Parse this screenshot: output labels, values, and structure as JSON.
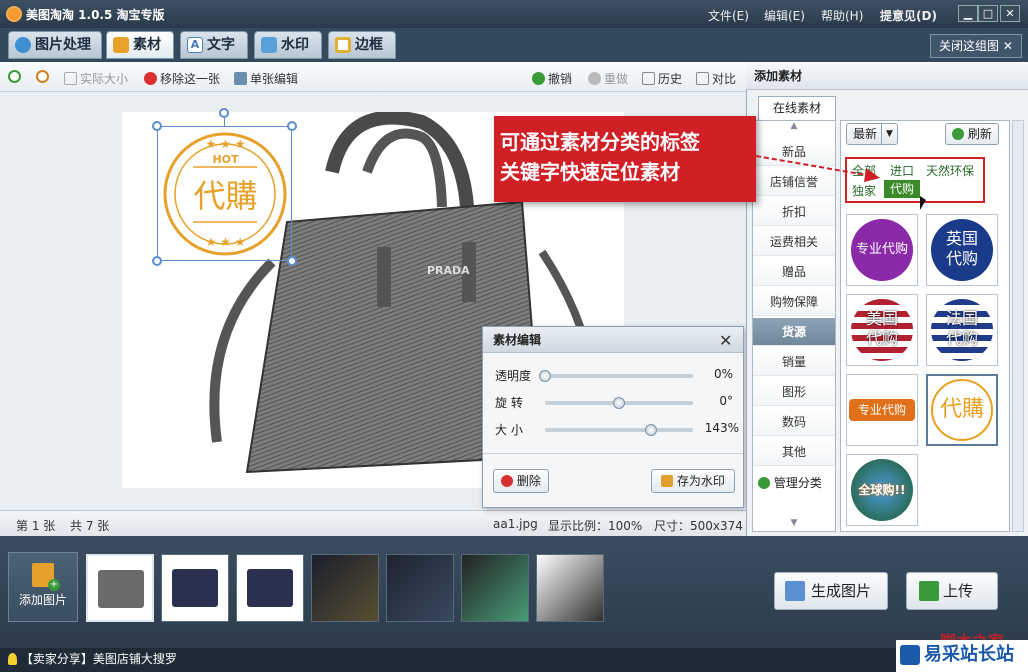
{
  "app": {
    "title": "美图淘淘 1.0.5 淘宝专版",
    "menus": [
      "文件(E)",
      "编辑(E)",
      "帮助(H)",
      "提意见(D)"
    ],
    "window_buttons": [
      "▁",
      "□",
      "✕"
    ]
  },
  "tabs": [
    {
      "label": "图片处理",
      "color": "#3f8fd4"
    },
    {
      "label": "素材",
      "color": "#e8a22a",
      "active": true
    },
    {
      "label": "文字",
      "color": "#4a7fb5"
    },
    {
      "label": "水印",
      "color": "#5aa0d8"
    },
    {
      "label": "边框",
      "color": "#e0b030"
    }
  ],
  "close_group": "关闭这组图 ✕",
  "toolbar": {
    "actual_size": "实际大小",
    "remove_one": "移除这一张",
    "single_edit": "单张编辑",
    "undo": "撤销",
    "redo": "重做",
    "history": "历史",
    "compare": "对比"
  },
  "stamp": {
    "hot": "HOT",
    "text": "代購",
    "stars": "★ ★ ★"
  },
  "bag_brand": "PRADA",
  "callout": {
    "line1": "可通过素材分类的标签",
    "line2": "关键字快速定位素材"
  },
  "status": {
    "page": "第 1 张",
    "total": "共 7 张",
    "filename": "aa1.jpg",
    "scale": "显示比例：100%",
    "size": "尺寸：500x374"
  },
  "dialog": {
    "title": "素材编辑",
    "sliders": [
      {
        "label": "透明度",
        "value_text": "0%",
        "level": 0.0
      },
      {
        "label": "旋 转",
        "value_text": "0°",
        "level": 0.5
      },
      {
        "label": "大 小",
        "value_text": "143%",
        "level": 0.72
      }
    ],
    "delete": "删除",
    "save_watermark": "存为水印"
  },
  "right_panel": {
    "header": "添加素材",
    "online_tab": "在线素材",
    "categories": [
      "新品",
      "店铺信誉",
      "折扣",
      "运费相关",
      "赠品",
      "购物保障",
      "货源",
      "销量",
      "图形",
      "数码",
      "其他"
    ],
    "selected_category": "货源",
    "manage": "管理分类",
    "sort": "最新",
    "refresh": "刷新",
    "tags": [
      "全部",
      "进口",
      "天然环保",
      "独家",
      "代购"
    ],
    "selected_tag": "代购",
    "stickers": [
      {
        "text": "专业代购",
        "color": "#8b2aa8"
      },
      {
        "text": "英国代购",
        "color": "#1a3a8a"
      },
      {
        "text": "美国代购",
        "color": "#b32030"
      },
      {
        "text": "法国代购",
        "color": "#203a8c"
      },
      {
        "text": "专业代购",
        "color": "#e0701a"
      },
      {
        "text": "代購",
        "color": "#e7a020"
      },
      {
        "text": "全球购!!",
        "color": "#2a7a3a"
      }
    ]
  },
  "filmstrip": {
    "add_label": "添加图片",
    "count": 7
  },
  "buttons": {
    "generate": "生成图片",
    "upload": "上传"
  },
  "bottom": {
    "share": "【卖家分享】美图店铺大搜罗",
    "watermark": "易采站长站",
    "watermark2": "脚本之家"
  }
}
